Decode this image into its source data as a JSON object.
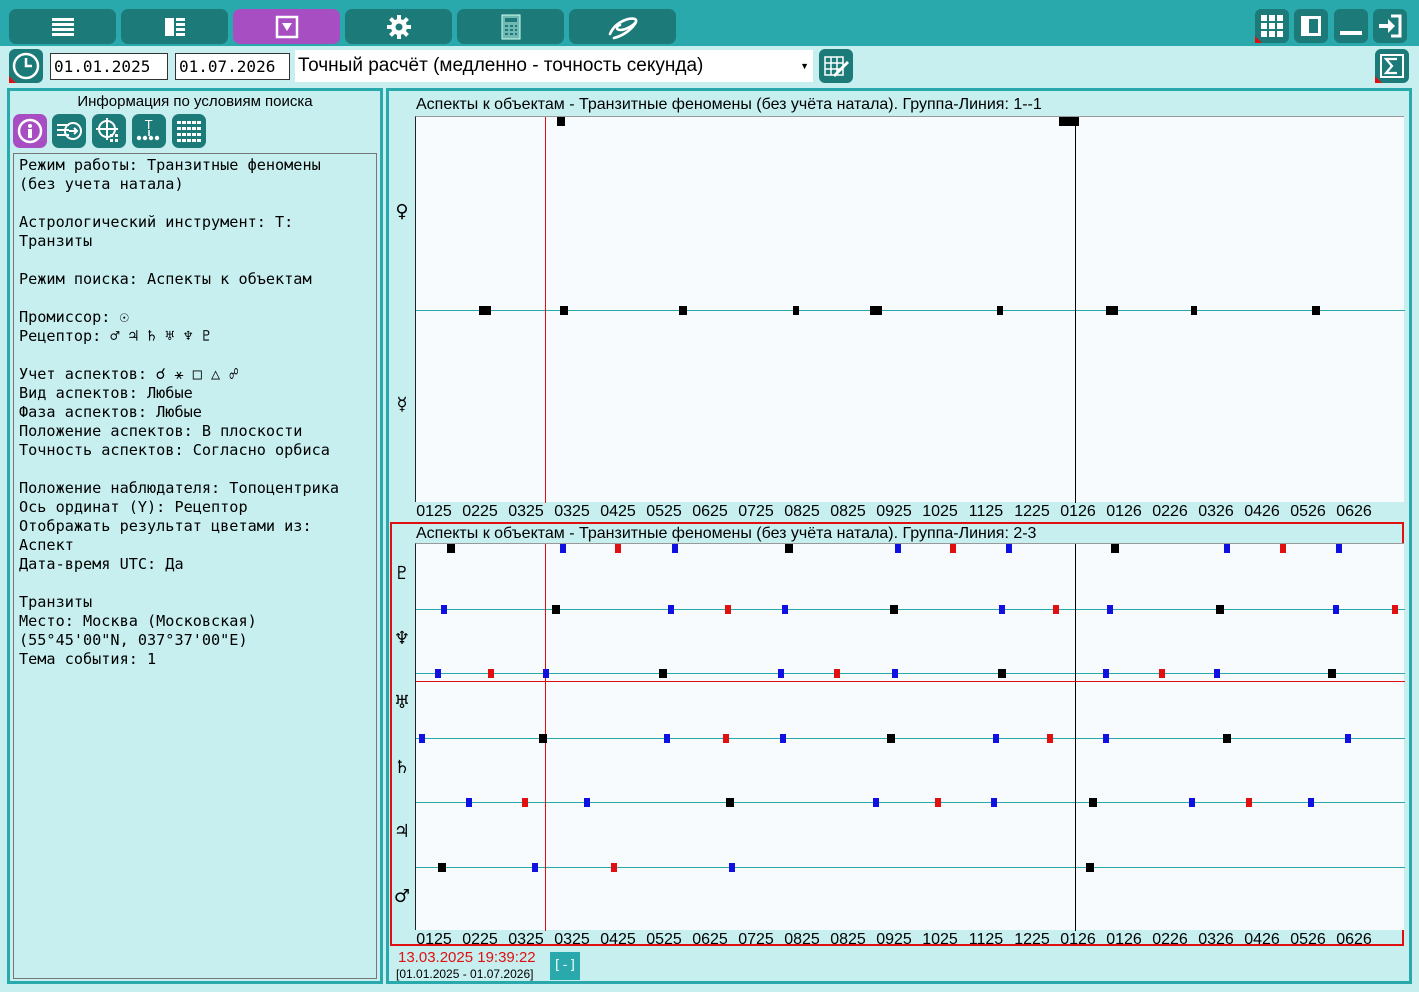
{
  "toolbar": {
    "buttons": [
      "menu",
      "table",
      "filter",
      "settings",
      "calculator",
      "logo"
    ],
    "right_buttons": [
      "grid",
      "panel",
      "minimize",
      "exit"
    ]
  },
  "dates": {
    "start": "01.01.2025",
    "end": "01.07.2026"
  },
  "calc_mode": {
    "selected": "Точный расчёт (медленно - точность секунда)"
  },
  "left": {
    "title": "Информация по условиям поиска",
    "info_lines": [
      "Режим работы: Транзитные феномены",
      "(без учета натала)",
      "",
      "Астрологический инструмент: T:",
      "Транзиты",
      "",
      "Режим поиска: Аспекты к объектам",
      "",
      "Промиссор: ☉",
      "Рецептор: ♂ ♃ ♄ ♅ ♆ ♇",
      "",
      "Учет аспектов: ☌ ⚹ □ △ ☍",
      "Вид аспектов: Любые",
      "Фаза аспектов: Любые",
      "Положение аспектов: В плоскости",
      "Точность аспектов: Согласно орбиса",
      "",
      "Положение наблюдателя: Топоцентрика",
      "Ось ординат (Y): Рецептор",
      "Отображать результат цветами из:",
      "Аспект",
      "Дата-время UTC: Да",
      "",
      "Транзиты",
      "Место: Москва (Московская)",
      "(55°45'00\"N, 037°37'00\"E)",
      "Тема события: 1"
    ]
  },
  "chart1": {
    "title": "Аспекты к объектам - Транзитные феномены (без учёта натала). Группа-Линия: 1--1",
    "rows": [
      "♀",
      "☿"
    ]
  },
  "chart2": {
    "title": "Аспекты к объектам - Транзитные феномены (без учёта натала). Группа-Линия: 2-3",
    "rows": [
      "♇",
      "♆",
      "♅",
      "♄",
      "♃",
      "♂"
    ]
  },
  "x_ticks": [
    "0125",
    "0225",
    "0325",
    "0325",
    "0425",
    "0525",
    "0625",
    "0725",
    "0825",
    "0825",
    "0925",
    "1025",
    "1125",
    "1225",
    "0126",
    "0126",
    "0226",
    "0326",
    "0426",
    "0526",
    "0626"
  ],
  "cursor": {
    "datetime": "13.03.2025 19:39:22",
    "range": "[01.01.2025 - 01.07.2026]",
    "toggle": "[-]"
  },
  "colors": {
    "accent": "#2aa9ad",
    "dark": "#1c7a79",
    "active": "#a74ec2",
    "cursor": "#e01010",
    "blue": "#1010e0",
    "black": "#000000"
  },
  "chart_data": [
    {
      "type": "scatter",
      "title": "Аспекты к объектам - Транзитные феномены (без учёта натала). Группа-Линия: 1--1",
      "rows": [
        "♀",
        "☿"
      ],
      "x_range": [
        "01.01.2025",
        "01.07.2026"
      ],
      "cursor_x": 0.196,
      "divider_x": 0.5,
      "marks": [
        {
          "row": 0,
          "x": 0.22,
          "w": 2,
          "c": "black"
        },
        {
          "row": 0,
          "x": 0.99,
          "w": 8,
          "c": "black"
        },
        {
          "row": 1,
          "x": 0.105,
          "w": 4,
          "c": "black"
        },
        {
          "row": 1,
          "x": 0.225,
          "w": 2,
          "c": "black"
        },
        {
          "row": 1,
          "x": 0.405,
          "w": 2,
          "c": "black"
        },
        {
          "row": 1,
          "x": 0.577,
          "w": 1,
          "c": "black"
        },
        {
          "row": 1,
          "x": 0.697,
          "w": 4,
          "c": "black"
        },
        {
          "row": 1,
          "x": 0.885,
          "w": 1,
          "c": "black"
        },
        {
          "row": 1,
          "x": 1.055,
          "w": 4,
          "c": "black"
        },
        {
          "row": 1,
          "x": 1.18,
          "w": 1,
          "c": "black"
        },
        {
          "row": 1,
          "x": 1.365,
          "w": 2,
          "c": "black"
        }
      ]
    },
    {
      "type": "scatter",
      "title": "Аспекты к объектам - Транзитные феномены (без учёта натала). Группа-Линия: 2-3",
      "rows": [
        "♇",
        "♆",
        "♅",
        "♄",
        "♃",
        "♂"
      ],
      "marks": [
        {
          "row": 0,
          "x": 0.053,
          "c": "black"
        },
        {
          "row": 0,
          "x": 0.223,
          "c": "blue"
        },
        {
          "row": 0,
          "x": 0.307,
          "c": "red"
        },
        {
          "row": 0,
          "x": 0.393,
          "c": "blue"
        },
        {
          "row": 0,
          "x": 0.565,
          "c": "black"
        },
        {
          "row": 0,
          "x": 0.731,
          "c": "blue"
        },
        {
          "row": 0,
          "x": 0.815,
          "c": "red"
        },
        {
          "row": 0,
          "x": 0.899,
          "c": "blue"
        },
        {
          "row": 0,
          "x": 1.06,
          "c": "black"
        },
        {
          "row": 0,
          "x": 1.23,
          "c": "blue"
        },
        {
          "row": 0,
          "x": 1.315,
          "c": "red"
        },
        {
          "row": 0,
          "x": 1.4,
          "c": "blue"
        },
        {
          "row": 1,
          "x": 0.043,
          "c": "blue"
        },
        {
          "row": 1,
          "x": 0.213,
          "c": "black"
        },
        {
          "row": 1,
          "x": 0.387,
          "c": "blue"
        },
        {
          "row": 1,
          "x": 0.473,
          "c": "red"
        },
        {
          "row": 1,
          "x": 0.559,
          "c": "blue"
        },
        {
          "row": 1,
          "x": 0.725,
          "c": "black"
        },
        {
          "row": 1,
          "x": 0.889,
          "c": "blue"
        },
        {
          "row": 1,
          "x": 0.971,
          "c": "red"
        },
        {
          "row": 1,
          "x": 1.053,
          "c": "blue"
        },
        {
          "row": 1,
          "x": 1.22,
          "c": "black"
        },
        {
          "row": 1,
          "x": 1.395,
          "c": "blue"
        },
        {
          "row": 1,
          "x": 1.485,
          "c": "red"
        },
        {
          "row": 2,
          "x": 0.033,
          "c": "blue"
        },
        {
          "row": 2,
          "x": 0.113,
          "c": "red"
        },
        {
          "row": 2,
          "x": 0.197,
          "c": "blue"
        },
        {
          "row": 2,
          "x": 0.375,
          "c": "black"
        },
        {
          "row": 2,
          "x": 0.553,
          "c": "blue"
        },
        {
          "row": 2,
          "x": 0.639,
          "c": "red"
        },
        {
          "row": 2,
          "x": 0.727,
          "c": "blue"
        },
        {
          "row": 2,
          "x": 0.889,
          "c": "black"
        },
        {
          "row": 2,
          "x": 1.047,
          "c": "blue"
        },
        {
          "row": 2,
          "x": 1.132,
          "c": "red"
        },
        {
          "row": 2,
          "x": 1.215,
          "c": "blue"
        },
        {
          "row": 2,
          "x": 1.39,
          "c": "black"
        },
        {
          "row": 3,
          "x": 0.009,
          "c": "blue"
        },
        {
          "row": 3,
          "x": 0.192,
          "c": "black"
        },
        {
          "row": 3,
          "x": 0.381,
          "c": "blue"
        },
        {
          "row": 3,
          "x": 0.47,
          "c": "red"
        },
        {
          "row": 3,
          "x": 0.556,
          "c": "blue"
        },
        {
          "row": 3,
          "x": 0.72,
          "c": "black"
        },
        {
          "row": 3,
          "x": 0.88,
          "c": "blue"
        },
        {
          "row": 3,
          "x": 0.962,
          "c": "red"
        },
        {
          "row": 3,
          "x": 1.047,
          "c": "blue"
        },
        {
          "row": 3,
          "x": 1.23,
          "c": "black"
        },
        {
          "row": 3,
          "x": 1.414,
          "c": "blue"
        },
        {
          "row": 4,
          "x": 0.081,
          "c": "blue"
        },
        {
          "row": 4,
          "x": 0.166,
          "c": "red"
        },
        {
          "row": 4,
          "x": 0.26,
          "c": "blue"
        },
        {
          "row": 4,
          "x": 0.476,
          "c": "black"
        },
        {
          "row": 4,
          "x": 0.698,
          "c": "blue"
        },
        {
          "row": 4,
          "x": 0.792,
          "c": "red"
        },
        {
          "row": 4,
          "x": 0.877,
          "c": "blue"
        },
        {
          "row": 4,
          "x": 1.027,
          "c": "black"
        },
        {
          "row": 4,
          "x": 1.177,
          "c": "blue"
        },
        {
          "row": 4,
          "x": 1.263,
          "c": "red"
        },
        {
          "row": 4,
          "x": 1.357,
          "c": "blue"
        },
        {
          "row": 5,
          "x": 0.039,
          "c": "black"
        },
        {
          "row": 5,
          "x": 0.181,
          "c": "blue"
        },
        {
          "row": 5,
          "x": 0.301,
          "c": "red"
        },
        {
          "row": 5,
          "x": 0.48,
          "c": "blue"
        },
        {
          "row": 5,
          "x": 1.023,
          "c": "black"
        }
      ]
    }
  ]
}
